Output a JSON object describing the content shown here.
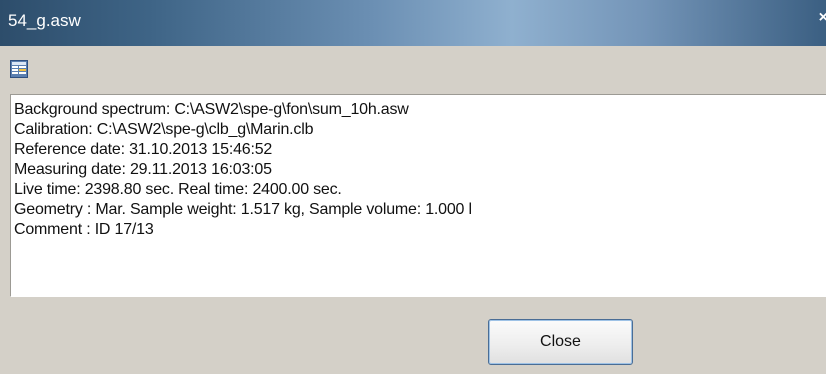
{
  "window": {
    "title": "54_g.asw",
    "close_glyph": "×"
  },
  "toolbar": {
    "icon": "report-view-icon"
  },
  "info": {
    "lines": [
      "Background spectrum:  C:\\ASW2\\spe-g\\fon\\sum_10h.asw",
      "Calibration:  C:\\ASW2\\spe-g\\clb_g\\Marin.clb",
      "Reference date: 31.10.2013  15:46:52",
      "Measuring date: 29.11.2013  16:03:05",
      "Live time: 2398.80 sec. Real time: 2400.00 sec.",
      "Geometry : Mar.  Sample weight: 1.517 kg,  Sample volume: 1.000 l",
      "Comment : ID 17/13"
    ]
  },
  "buttons": {
    "close_label": "Close"
  }
}
